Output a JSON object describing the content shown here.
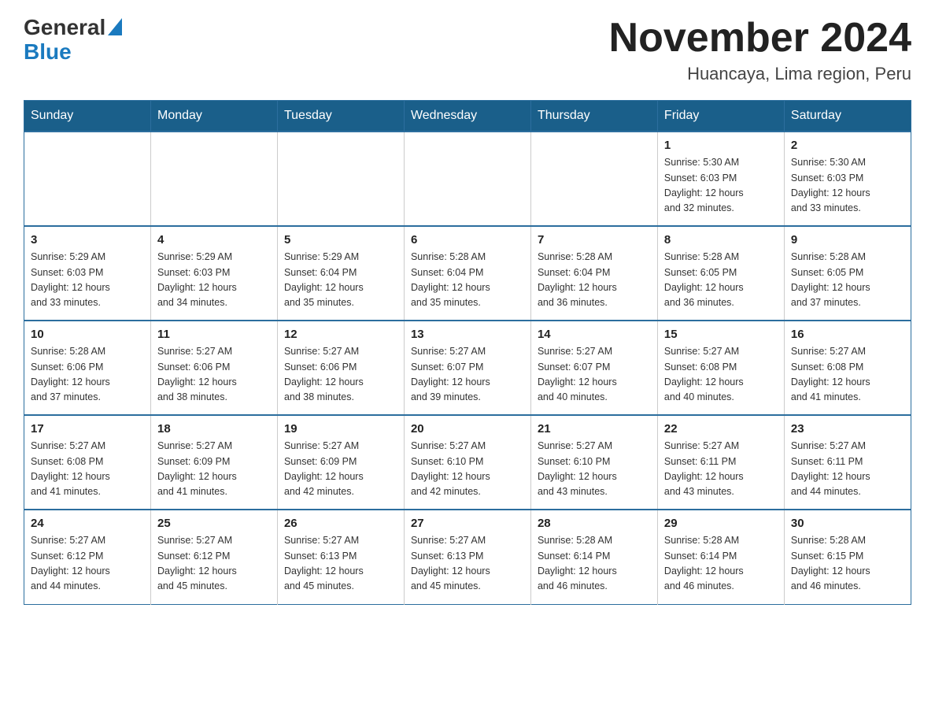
{
  "header": {
    "logo_text_general": "General",
    "logo_text_blue": "Blue",
    "month_title": "November 2024",
    "location": "Huancaya, Lima region, Peru"
  },
  "days_of_week": [
    "Sunday",
    "Monday",
    "Tuesday",
    "Wednesday",
    "Thursday",
    "Friday",
    "Saturday"
  ],
  "weeks": [
    [
      {
        "day": "",
        "info": ""
      },
      {
        "day": "",
        "info": ""
      },
      {
        "day": "",
        "info": ""
      },
      {
        "day": "",
        "info": ""
      },
      {
        "day": "",
        "info": ""
      },
      {
        "day": "1",
        "info": "Sunrise: 5:30 AM\nSunset: 6:03 PM\nDaylight: 12 hours\nand 32 minutes."
      },
      {
        "day": "2",
        "info": "Sunrise: 5:30 AM\nSunset: 6:03 PM\nDaylight: 12 hours\nand 33 minutes."
      }
    ],
    [
      {
        "day": "3",
        "info": "Sunrise: 5:29 AM\nSunset: 6:03 PM\nDaylight: 12 hours\nand 33 minutes."
      },
      {
        "day": "4",
        "info": "Sunrise: 5:29 AM\nSunset: 6:03 PM\nDaylight: 12 hours\nand 34 minutes."
      },
      {
        "day": "5",
        "info": "Sunrise: 5:29 AM\nSunset: 6:04 PM\nDaylight: 12 hours\nand 35 minutes."
      },
      {
        "day": "6",
        "info": "Sunrise: 5:28 AM\nSunset: 6:04 PM\nDaylight: 12 hours\nand 35 minutes."
      },
      {
        "day": "7",
        "info": "Sunrise: 5:28 AM\nSunset: 6:04 PM\nDaylight: 12 hours\nand 36 minutes."
      },
      {
        "day": "8",
        "info": "Sunrise: 5:28 AM\nSunset: 6:05 PM\nDaylight: 12 hours\nand 36 minutes."
      },
      {
        "day": "9",
        "info": "Sunrise: 5:28 AM\nSunset: 6:05 PM\nDaylight: 12 hours\nand 37 minutes."
      }
    ],
    [
      {
        "day": "10",
        "info": "Sunrise: 5:28 AM\nSunset: 6:06 PM\nDaylight: 12 hours\nand 37 minutes."
      },
      {
        "day": "11",
        "info": "Sunrise: 5:27 AM\nSunset: 6:06 PM\nDaylight: 12 hours\nand 38 minutes."
      },
      {
        "day": "12",
        "info": "Sunrise: 5:27 AM\nSunset: 6:06 PM\nDaylight: 12 hours\nand 38 minutes."
      },
      {
        "day": "13",
        "info": "Sunrise: 5:27 AM\nSunset: 6:07 PM\nDaylight: 12 hours\nand 39 minutes."
      },
      {
        "day": "14",
        "info": "Sunrise: 5:27 AM\nSunset: 6:07 PM\nDaylight: 12 hours\nand 40 minutes."
      },
      {
        "day": "15",
        "info": "Sunrise: 5:27 AM\nSunset: 6:08 PM\nDaylight: 12 hours\nand 40 minutes."
      },
      {
        "day": "16",
        "info": "Sunrise: 5:27 AM\nSunset: 6:08 PM\nDaylight: 12 hours\nand 41 minutes."
      }
    ],
    [
      {
        "day": "17",
        "info": "Sunrise: 5:27 AM\nSunset: 6:08 PM\nDaylight: 12 hours\nand 41 minutes."
      },
      {
        "day": "18",
        "info": "Sunrise: 5:27 AM\nSunset: 6:09 PM\nDaylight: 12 hours\nand 41 minutes."
      },
      {
        "day": "19",
        "info": "Sunrise: 5:27 AM\nSunset: 6:09 PM\nDaylight: 12 hours\nand 42 minutes."
      },
      {
        "day": "20",
        "info": "Sunrise: 5:27 AM\nSunset: 6:10 PM\nDaylight: 12 hours\nand 42 minutes."
      },
      {
        "day": "21",
        "info": "Sunrise: 5:27 AM\nSunset: 6:10 PM\nDaylight: 12 hours\nand 43 minutes."
      },
      {
        "day": "22",
        "info": "Sunrise: 5:27 AM\nSunset: 6:11 PM\nDaylight: 12 hours\nand 43 minutes."
      },
      {
        "day": "23",
        "info": "Sunrise: 5:27 AM\nSunset: 6:11 PM\nDaylight: 12 hours\nand 44 minutes."
      }
    ],
    [
      {
        "day": "24",
        "info": "Sunrise: 5:27 AM\nSunset: 6:12 PM\nDaylight: 12 hours\nand 44 minutes."
      },
      {
        "day": "25",
        "info": "Sunrise: 5:27 AM\nSunset: 6:12 PM\nDaylight: 12 hours\nand 45 minutes."
      },
      {
        "day": "26",
        "info": "Sunrise: 5:27 AM\nSunset: 6:13 PM\nDaylight: 12 hours\nand 45 minutes."
      },
      {
        "day": "27",
        "info": "Sunrise: 5:27 AM\nSunset: 6:13 PM\nDaylight: 12 hours\nand 45 minutes."
      },
      {
        "day": "28",
        "info": "Sunrise: 5:28 AM\nSunset: 6:14 PM\nDaylight: 12 hours\nand 46 minutes."
      },
      {
        "day": "29",
        "info": "Sunrise: 5:28 AM\nSunset: 6:14 PM\nDaylight: 12 hours\nand 46 minutes."
      },
      {
        "day": "30",
        "info": "Sunrise: 5:28 AM\nSunset: 6:15 PM\nDaylight: 12 hours\nand 46 minutes."
      }
    ]
  ]
}
